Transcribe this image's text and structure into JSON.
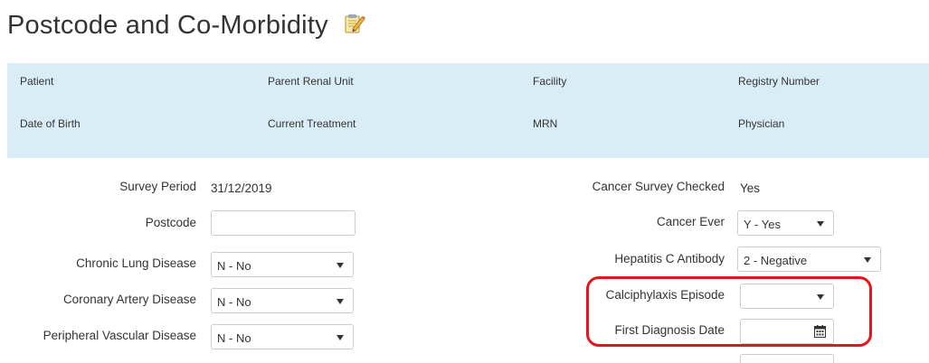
{
  "page": {
    "title": "Postcode and Co-Morbidity",
    "edit_icon": "edit-notepad-icon"
  },
  "patient_info": {
    "patient": "Patient",
    "parent_renal_unit": "Parent Renal Unit",
    "facility": "Facility",
    "registry_number": "Registry Number",
    "date_of_birth": "Date of Birth",
    "current_treatment": "Current Treatment",
    "mrn": "MRN",
    "physician": "Physician"
  },
  "form": {
    "survey_period": {
      "label": "Survey Period",
      "value": "31/12/2019"
    },
    "postcode": {
      "label": "Postcode",
      "value": ""
    },
    "chronic_lung_disease": {
      "label": "Chronic Lung Disease",
      "value": "N - No"
    },
    "coronary_artery_disease": {
      "label": "Coronary Artery Disease",
      "value": "N - No"
    },
    "peripheral_vascular_disease": {
      "label": "Peripheral Vascular Disease",
      "value": "N - No"
    },
    "cancer_survey_checked": {
      "label": "Cancer Survey Checked",
      "value": "Yes"
    },
    "cancer_ever": {
      "label": "Cancer Ever",
      "value": "Y - Yes"
    },
    "hepatitis_c_antibody": {
      "label": "Hepatitis C Antibody",
      "value": "2 - Negative"
    },
    "calciphylaxis_episode": {
      "label": "Calciphylaxis Episode",
      "value": ""
    },
    "first_diagnosis_date": {
      "label": "First Diagnosis Date",
      "value": ""
    }
  },
  "colors": {
    "info_panel_bg": "#d9edf7",
    "highlight": "#e8141c",
    "input_border": "#cccccc"
  }
}
